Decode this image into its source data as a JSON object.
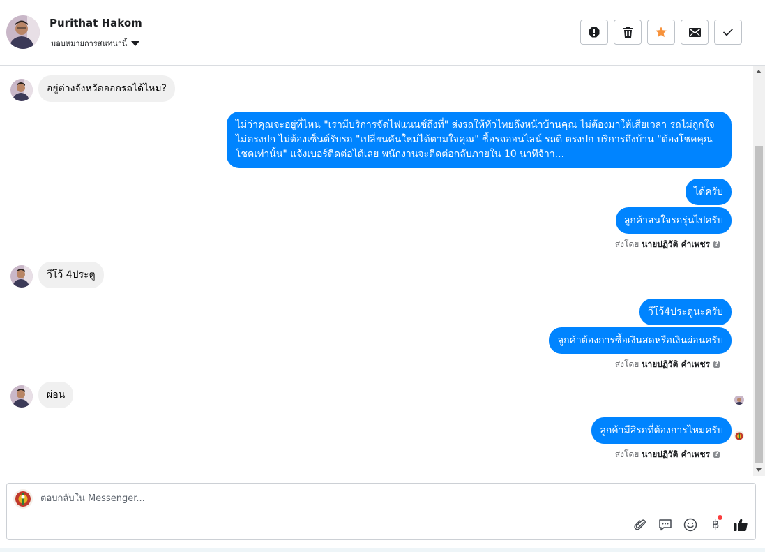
{
  "header": {
    "contact_name": "Purithat Hakom",
    "assign_label": "มอบหมายการสนทนานี้",
    "actions": [
      {
        "name": "mark-spam-button",
        "icon": "alert-icon"
      },
      {
        "name": "delete-button",
        "icon": "trash-icon"
      },
      {
        "name": "star-button",
        "icon": "star-icon"
      },
      {
        "name": "mark-unread-button",
        "icon": "envelope-icon"
      },
      {
        "name": "mark-done-button",
        "icon": "check-icon"
      }
    ]
  },
  "messages": {
    "in1": "อยู่ต่างจังหวัดออกรถได้ไหม?",
    "out1": "ไม่ว่าคุณจะอยู่ที่ไหน \"เรามีบริการจัดไฟแนนซ์ถึงที่\"  ส่งรถให้ทั่วไทยถึงหน้าบ้านคุณ ไม่ต้องมาให้เสียเวลา รถไม่ถูกใจ ไม่ตรงปก ไม่ต้องเซ็นต์รับรถ \"เปลี่ยนคันใหม่ได้ตามใจคุณ\" ซื้อรถออนไลน์ รถดี ตรงปก บริการถึงบ้าน \"ต้องโชคคุณโชคเท่านั้น\" แจ้งเบอร์ติดต่อได้เลย พนักงานจะติดต่อกลับภายใน 10 นาทีจ้าา...",
    "out2": "ได้ครับ",
    "out3": "ลูกค้าสนใจรถรุ่นไปครับ",
    "in2": "วีโว้ 4ประตู",
    "out4": "วีโว้4ประตูนะครับ",
    "out5": "ลูกค้าต้องการซื้อเงินสดหรือเงินผ่อนครับ",
    "in3": "ผ่อน",
    "out6": "ลูกค้ามีสีรถที่ต้องการไหมครับ"
  },
  "sent_by": {
    "prefix": "ส่งโดย",
    "agent": "นายปฏิวัติ คำเพชร",
    "help": "?"
  },
  "composer": {
    "placeholder": "ตอบกลับใน Messenger...",
    "baht_symbol": "฿"
  },
  "colors": {
    "outgoing_bubble": "#0084ff",
    "incoming_bubble": "#f0f0f0",
    "star": "#f7923b"
  }
}
